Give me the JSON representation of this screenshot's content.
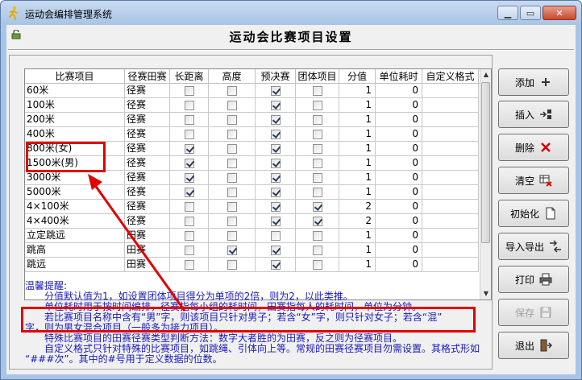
{
  "window": {
    "title": "运动会编排管理系统",
    "controls": [
      "▁",
      "▭",
      "✕"
    ]
  },
  "page": {
    "heading": "运动会比赛项目设置"
  },
  "grid": {
    "headers": [
      "比赛项目",
      "径赛田赛",
      "长距离",
      "高度",
      "预决赛",
      "团体项目",
      "分值",
      "单位耗时",
      "自定义格式"
    ],
    "rows": [
      {
        "name": "60米",
        "type": "径赛",
        "long": false,
        "height": false,
        "prelim": true,
        "team": false,
        "score": "1",
        "unit_time": "0",
        "format": ""
      },
      {
        "name": "100米",
        "type": "径赛",
        "long": false,
        "height": false,
        "prelim": true,
        "team": false,
        "score": "1",
        "unit_time": "0",
        "format": ""
      },
      {
        "name": "200米",
        "type": "径赛",
        "long": false,
        "height": false,
        "prelim": true,
        "team": false,
        "score": "1",
        "unit_time": "0",
        "format": ""
      },
      {
        "name": "400米",
        "type": "径赛",
        "long": false,
        "height": false,
        "prelim": true,
        "team": false,
        "score": "1",
        "unit_time": "0",
        "format": ""
      },
      {
        "name": "800米(女)",
        "type": "径赛",
        "long": true,
        "height": false,
        "prelim": true,
        "team": false,
        "score": "1",
        "unit_time": "0",
        "format": ""
      },
      {
        "name": "1500米(男)",
        "type": "径赛",
        "long": true,
        "height": false,
        "prelim": true,
        "team": false,
        "score": "1",
        "unit_time": "0",
        "format": ""
      },
      {
        "name": "3000米",
        "type": "径赛",
        "long": true,
        "height": false,
        "prelim": true,
        "team": false,
        "score": "1",
        "unit_time": "0",
        "format": ""
      },
      {
        "name": "5000米",
        "type": "径赛",
        "long": true,
        "height": false,
        "prelim": true,
        "team": false,
        "score": "1",
        "unit_time": "0",
        "format": ""
      },
      {
        "name": "4×100米",
        "type": "径赛",
        "long": false,
        "height": false,
        "prelim": true,
        "team": true,
        "score": "2",
        "unit_time": "0",
        "format": ""
      },
      {
        "name": "4×400米",
        "type": "径赛",
        "long": false,
        "height": false,
        "prelim": true,
        "team": true,
        "score": "2",
        "unit_time": "0",
        "format": ""
      },
      {
        "name": "立定跳远",
        "type": "田赛",
        "long": false,
        "height": false,
        "prelim": false,
        "team": false,
        "score": "1",
        "unit_time": "0",
        "format": ""
      },
      {
        "name": "跳高",
        "type": "田赛",
        "long": false,
        "height": true,
        "prelim": true,
        "team": false,
        "score": "1",
        "unit_time": "0",
        "format": ""
      },
      {
        "name": "跳远",
        "type": "田赛",
        "long": false,
        "height": false,
        "prelim": true,
        "team": false,
        "score": "1",
        "unit_time": "0",
        "format": ""
      }
    ]
  },
  "notes": {
    "title": "温馨提醒:",
    "lines": [
      "分值默认值为1，如设置团体项目得分为单项的2倍，则为2，以此类推。",
      "单位耗时用于按时间编排，径赛指每小组的耗时间，田赛指每人的耗时间，单位为分钟。",
      "若比赛项目名称中含有“男”字，则该项目只针对男子；若含“女”字，则只针对女子；若含“混”",
      "字，则为男女混合项目（一般多为接力项目）。",
      "特殊比赛项目的田赛径赛类型判断方法：数字大者胜的为田赛，反之则为径赛项目。",
      "自定义格式只针对特殊的比赛项目，如跳绳、引体向上等。常规的田赛径赛项目勿需设置。其格式形如",
      "“###次”。其中的#号用于定义数据的位数。"
    ]
  },
  "buttons": {
    "add": "添加",
    "insert": "插入",
    "delete": "删除",
    "clear": "清空",
    "init": "初始化",
    "import_export": "导入导出",
    "print": "打印",
    "save": "保存",
    "exit": "退出"
  },
  "colors": {
    "highlight_red": "#e00000",
    "note_blue": "#1a1ab8",
    "window_frame": "#a9c4e4"
  }
}
